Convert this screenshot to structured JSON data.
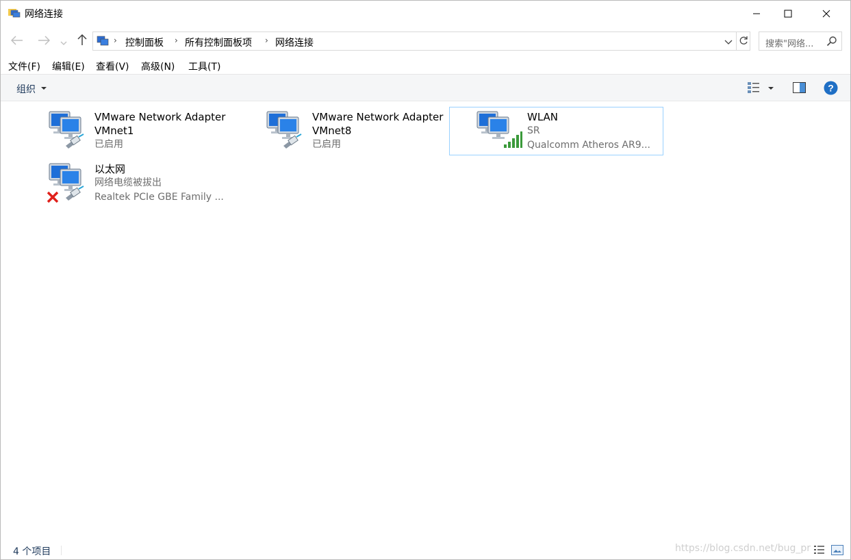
{
  "window": {
    "title": "网络连接",
    "accent": "#1f78d1",
    "minimize_icon": "minimize-icon",
    "maximize_icon": "maximize-icon",
    "close_icon": "close-icon"
  },
  "navigation": {
    "back_icon": "arrow-left-icon",
    "forward_icon": "arrow-right-icon",
    "recent_icon": "chevron-down-icon",
    "up_icon": "arrow-up-icon",
    "breadcrumb": [
      "控制面板",
      "所有控制面板项",
      "网络连接"
    ],
    "search_placeholder": "搜索\"网络..."
  },
  "menu": [
    "文件(F)",
    "编辑(E)",
    "查看(V)",
    "高级(N)",
    "工具(T)"
  ],
  "commandbar": {
    "organize_label": "组织",
    "view_icon": "change-view-icon",
    "preview_pane_icon": "preview-pane-icon",
    "help_icon": "help-icon"
  },
  "connections": [
    {
      "name": "VMware Network Adapter VMnet1",
      "line1": "VMware Network Adapter",
      "line2": "VMnet1",
      "status": "已启用",
      "device": "",
      "badge": "cable",
      "selected": false
    },
    {
      "name": "VMware Network Adapter VMnet8",
      "line1": "VMware Network Adapter",
      "line2": "VMnet8",
      "status": "已启用",
      "device": "",
      "badge": "cable",
      "selected": false
    },
    {
      "name": "WLAN",
      "line1": "WLAN",
      "line2": "SR",
      "status": "Qualcomm Atheros AR9...",
      "device": "Qualcomm Atheros AR9...",
      "badge": "signal",
      "selected": true
    },
    {
      "name": "以太网",
      "line1": "以太网",
      "line2": "网络电缆被拔出",
      "status": "Realtek PCIe GBE Family ...",
      "device": "Realtek PCIe GBE Family ...",
      "badge": "disconnected",
      "selected": false
    }
  ],
  "statusbar": {
    "count": "4 个项目",
    "watermark": "https://blog.csdn.net/bug_pr",
    "details_view_icon": "details-view-icon",
    "large-icons_view_icon": "large-icons-view-icon"
  }
}
